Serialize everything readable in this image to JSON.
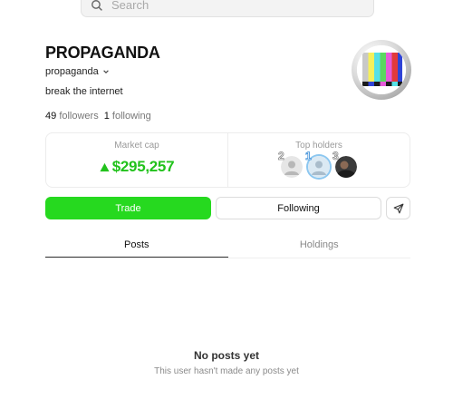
{
  "search": {
    "placeholder": "Search"
  },
  "profile": {
    "name": "PROPAGANDA",
    "handle": "propaganda",
    "bio": "break the internet",
    "followers_count": "49",
    "followers_label": "followers",
    "following_count": "1",
    "following_label": "following"
  },
  "stats": {
    "market_cap_label": "Market cap",
    "market_cap_value": "$295,257",
    "top_holders_label": "Top holders",
    "holders": [
      {
        "rank": "2"
      },
      {
        "rank": "1"
      },
      {
        "rank": "3"
      }
    ]
  },
  "actions": {
    "trade_label": "Trade",
    "following_label": "Following"
  },
  "tabs": [
    {
      "label": "Posts",
      "active": true
    },
    {
      "label": "Holdings",
      "active": false
    }
  ],
  "empty_state": {
    "title": "No posts yet",
    "subtitle": "This user hasn't made any posts yet"
  },
  "colors": {
    "accent_green": "#26d91f",
    "market_cap_green": "#22c21c"
  },
  "icons": {
    "search": "search-icon",
    "handle_menu": "chevron-down-icon",
    "market_trend": "triangle-up-icon",
    "share": "send-icon"
  }
}
